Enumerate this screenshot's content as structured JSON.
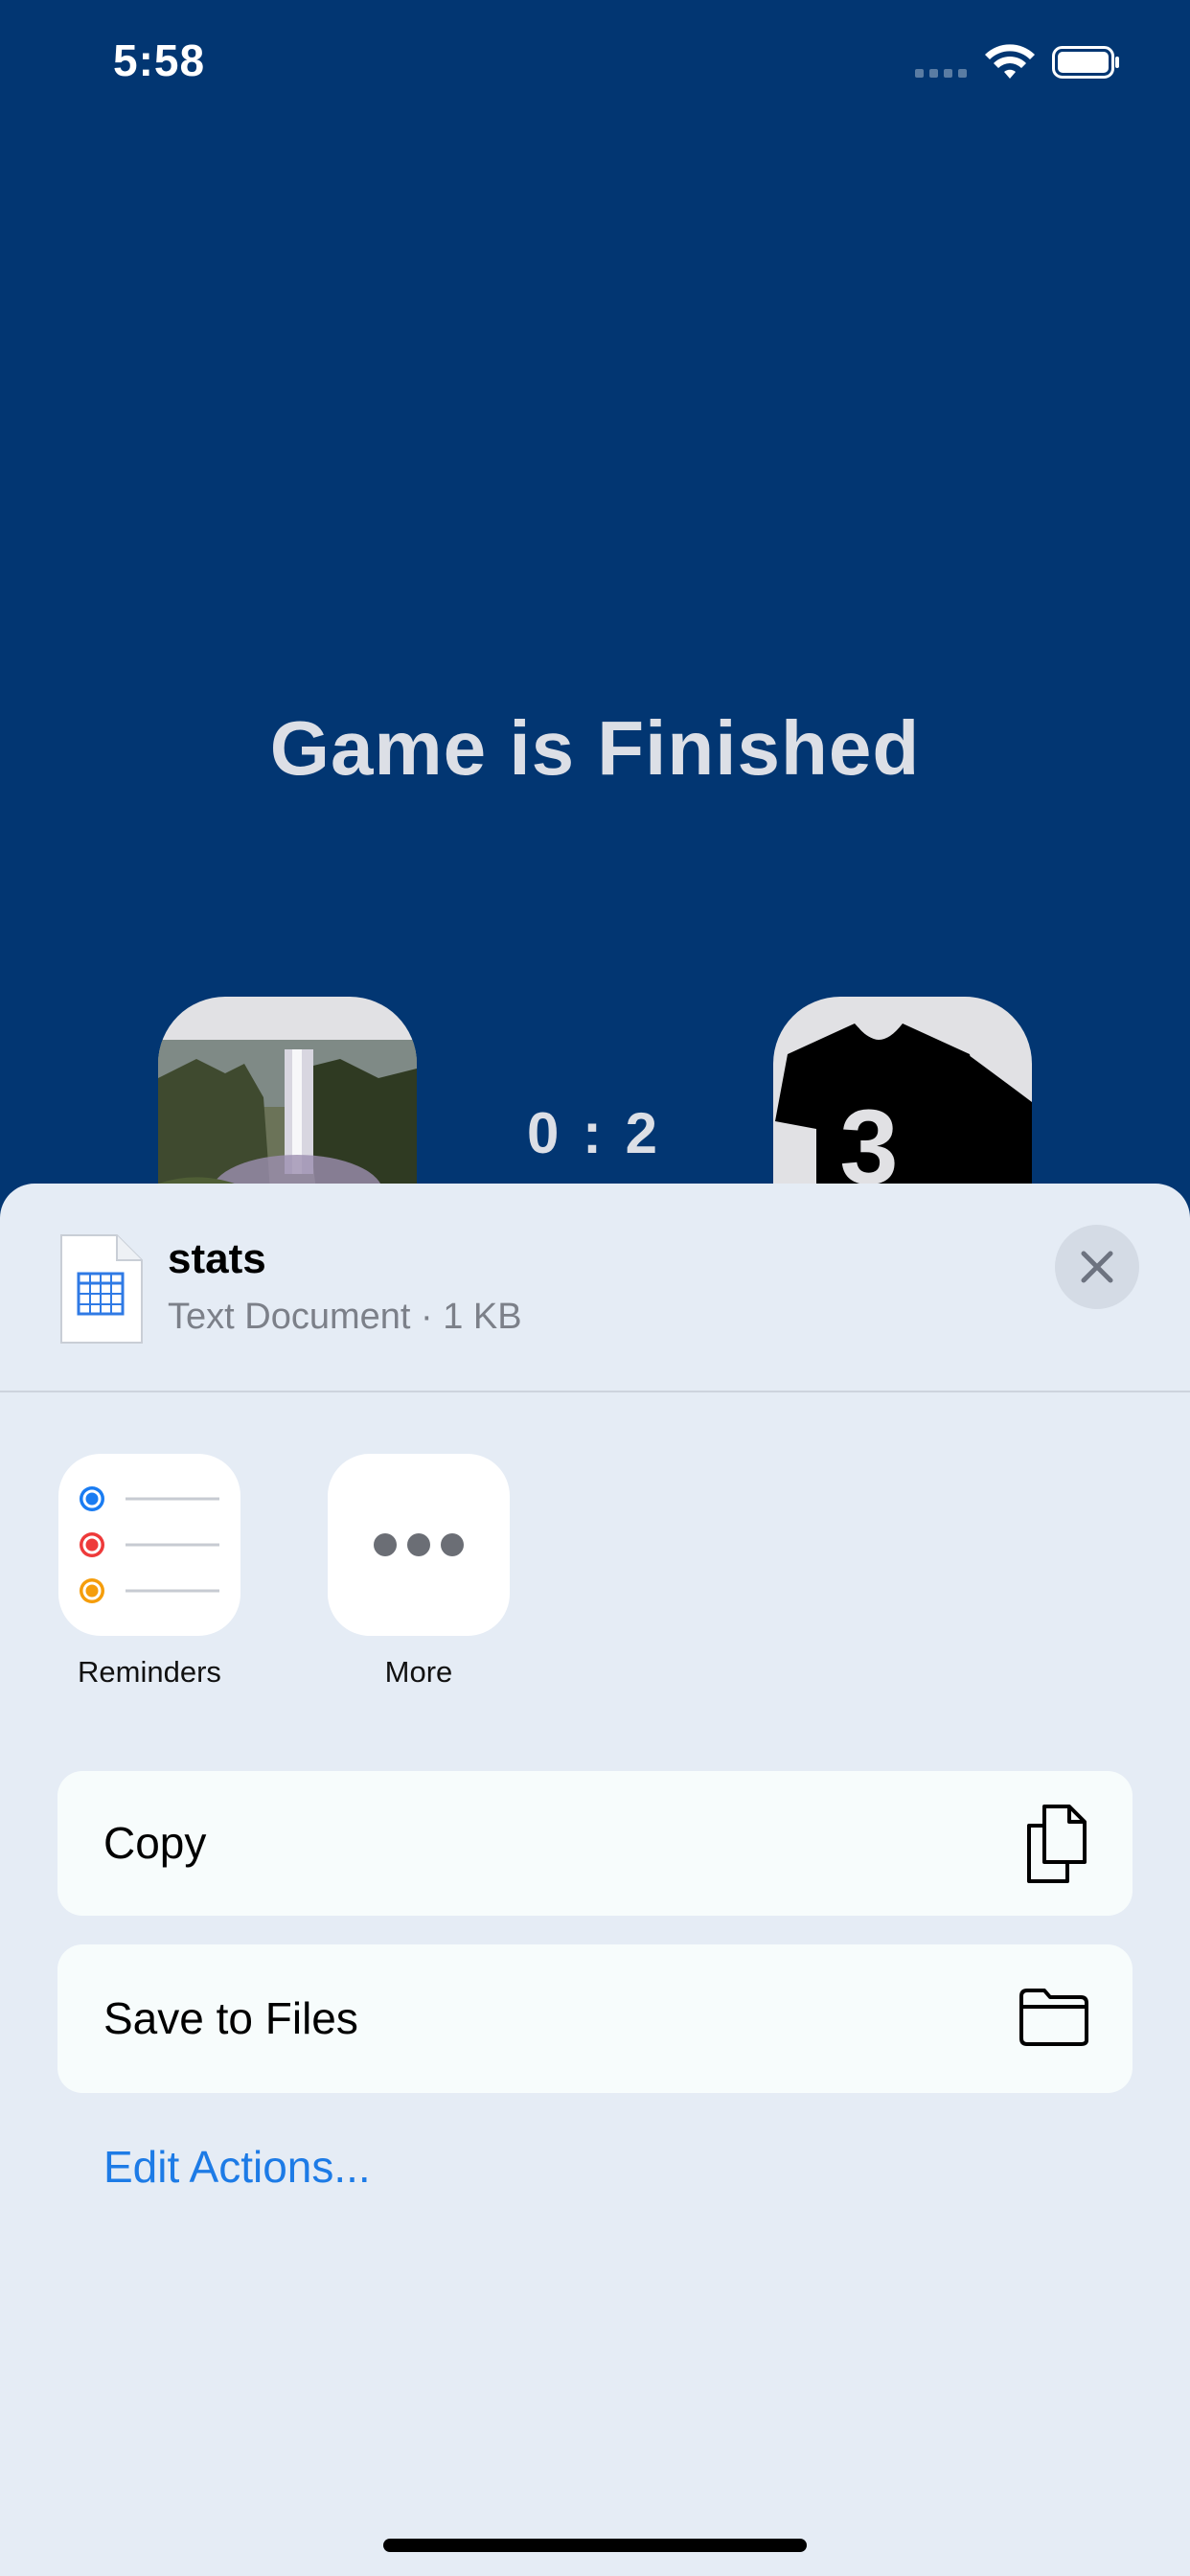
{
  "status": {
    "time": "5:58"
  },
  "game": {
    "title": "Game is Finished",
    "score": "0 : 2",
    "right_team_number": "3"
  },
  "share_sheet": {
    "file_name": "stats",
    "file_meta": "Text Document · 1 KB",
    "apps": [
      {
        "label": "Reminders",
        "icon": "reminders-icon"
      },
      {
        "label": "More",
        "icon": "more-icon"
      }
    ],
    "actions": [
      {
        "label": "Copy",
        "icon": "copy-icon"
      },
      {
        "label": "Save to Files",
        "icon": "folder-icon"
      }
    ],
    "edit_actions_label": "Edit Actions...",
    "colors": {
      "background": "#023672",
      "sheet": "#e5ecf5",
      "link": "#1d7be6"
    }
  }
}
